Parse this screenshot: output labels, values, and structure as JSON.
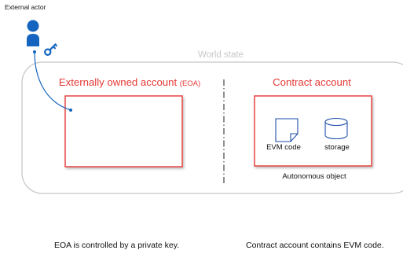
{
  "external_actor": {
    "label": "External actor"
  },
  "world_state": {
    "label": "World state"
  },
  "eoa": {
    "title": "Externally owned account",
    "abbr": "(EOA)"
  },
  "contract": {
    "title": "Contract account",
    "evm_code_label": "EVM code",
    "storage_label": "storage",
    "autonomous_label": "Autonomous object"
  },
  "captions": {
    "left": "EOA is controlled by a private key.",
    "right": "Contract account contains EVM code."
  },
  "colors": {
    "accent_red": "#e53935",
    "actor_blue": "#1565c0",
    "world_border": "#c8c8c8"
  },
  "icons": [
    "user-icon",
    "key-icon",
    "document-icon",
    "database-icon"
  ]
}
